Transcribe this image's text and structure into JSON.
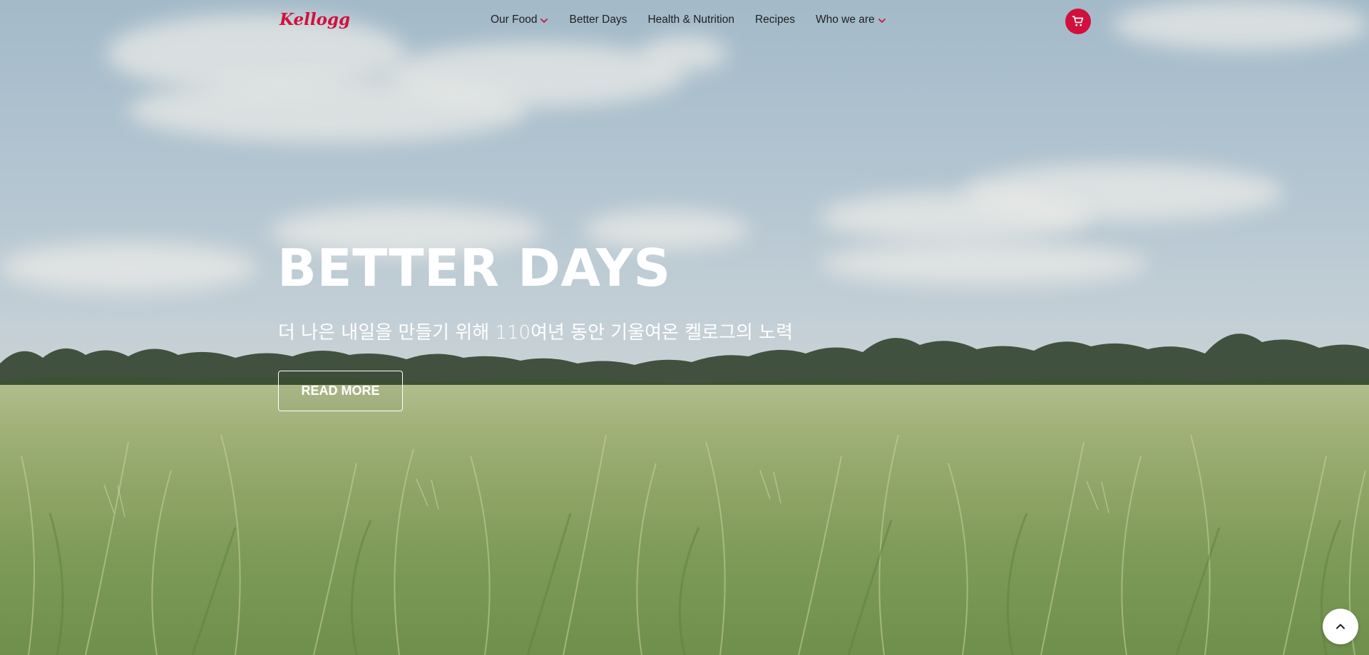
{
  "brand": {
    "logo_text": "Kellogg's",
    "accent_color": "#d1103e"
  },
  "nav": {
    "items": [
      {
        "label": "Our Food",
        "has_dropdown": true
      },
      {
        "label": "Better Days",
        "has_dropdown": false
      },
      {
        "label": "Health & Nutrition",
        "has_dropdown": false
      },
      {
        "label": "Recipes",
        "has_dropdown": false
      },
      {
        "label": "Who we are",
        "has_dropdown": true
      }
    ],
    "cart_icon": "shopping-cart-icon"
  },
  "hero": {
    "title": "BETTER DAYS",
    "subtitle": "더 나은 내일을 만들기 위해 110여년 동안 기울여온 켈로그의 노력",
    "button_label": "READ MORE",
    "background": "wheat-field-under-cloudy-sky"
  },
  "scroll_top_icon": "chevron-up-icon"
}
